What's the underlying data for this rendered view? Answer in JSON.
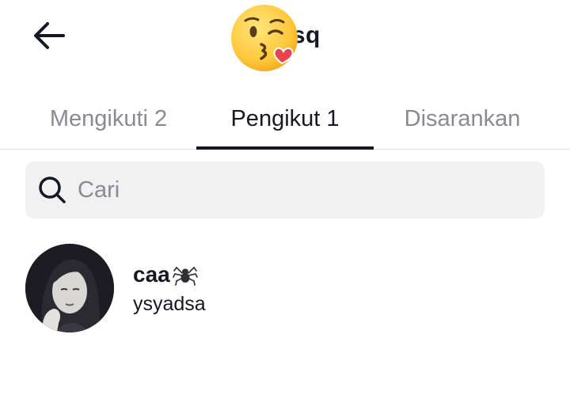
{
  "header": {
    "back_icon": "arrow-left-icon",
    "title_emoji": "kissing-face-with-heart-emoji",
    "title_visible_text": "nsq"
  },
  "tabs": [
    {
      "label": "Mengikuti 2",
      "active": false
    },
    {
      "label": "Pengikut 1",
      "active": true
    },
    {
      "label": "Disarankan",
      "active": false
    }
  ],
  "search": {
    "icon": "search-icon",
    "placeholder": "Cari",
    "value": ""
  },
  "users": [
    {
      "name": "caa",
      "name_icon": "spider-icon",
      "handle": "ysyadsa",
      "avatar": "profile-photo"
    }
  ],
  "colors": {
    "text_primary": "#161823",
    "text_secondary": "#8a8b91",
    "search_bg": "#f1f1f2",
    "divider": "#e3e3e4",
    "emoji_yellow": "#ffc83d",
    "heart_red": "#e8434f"
  }
}
